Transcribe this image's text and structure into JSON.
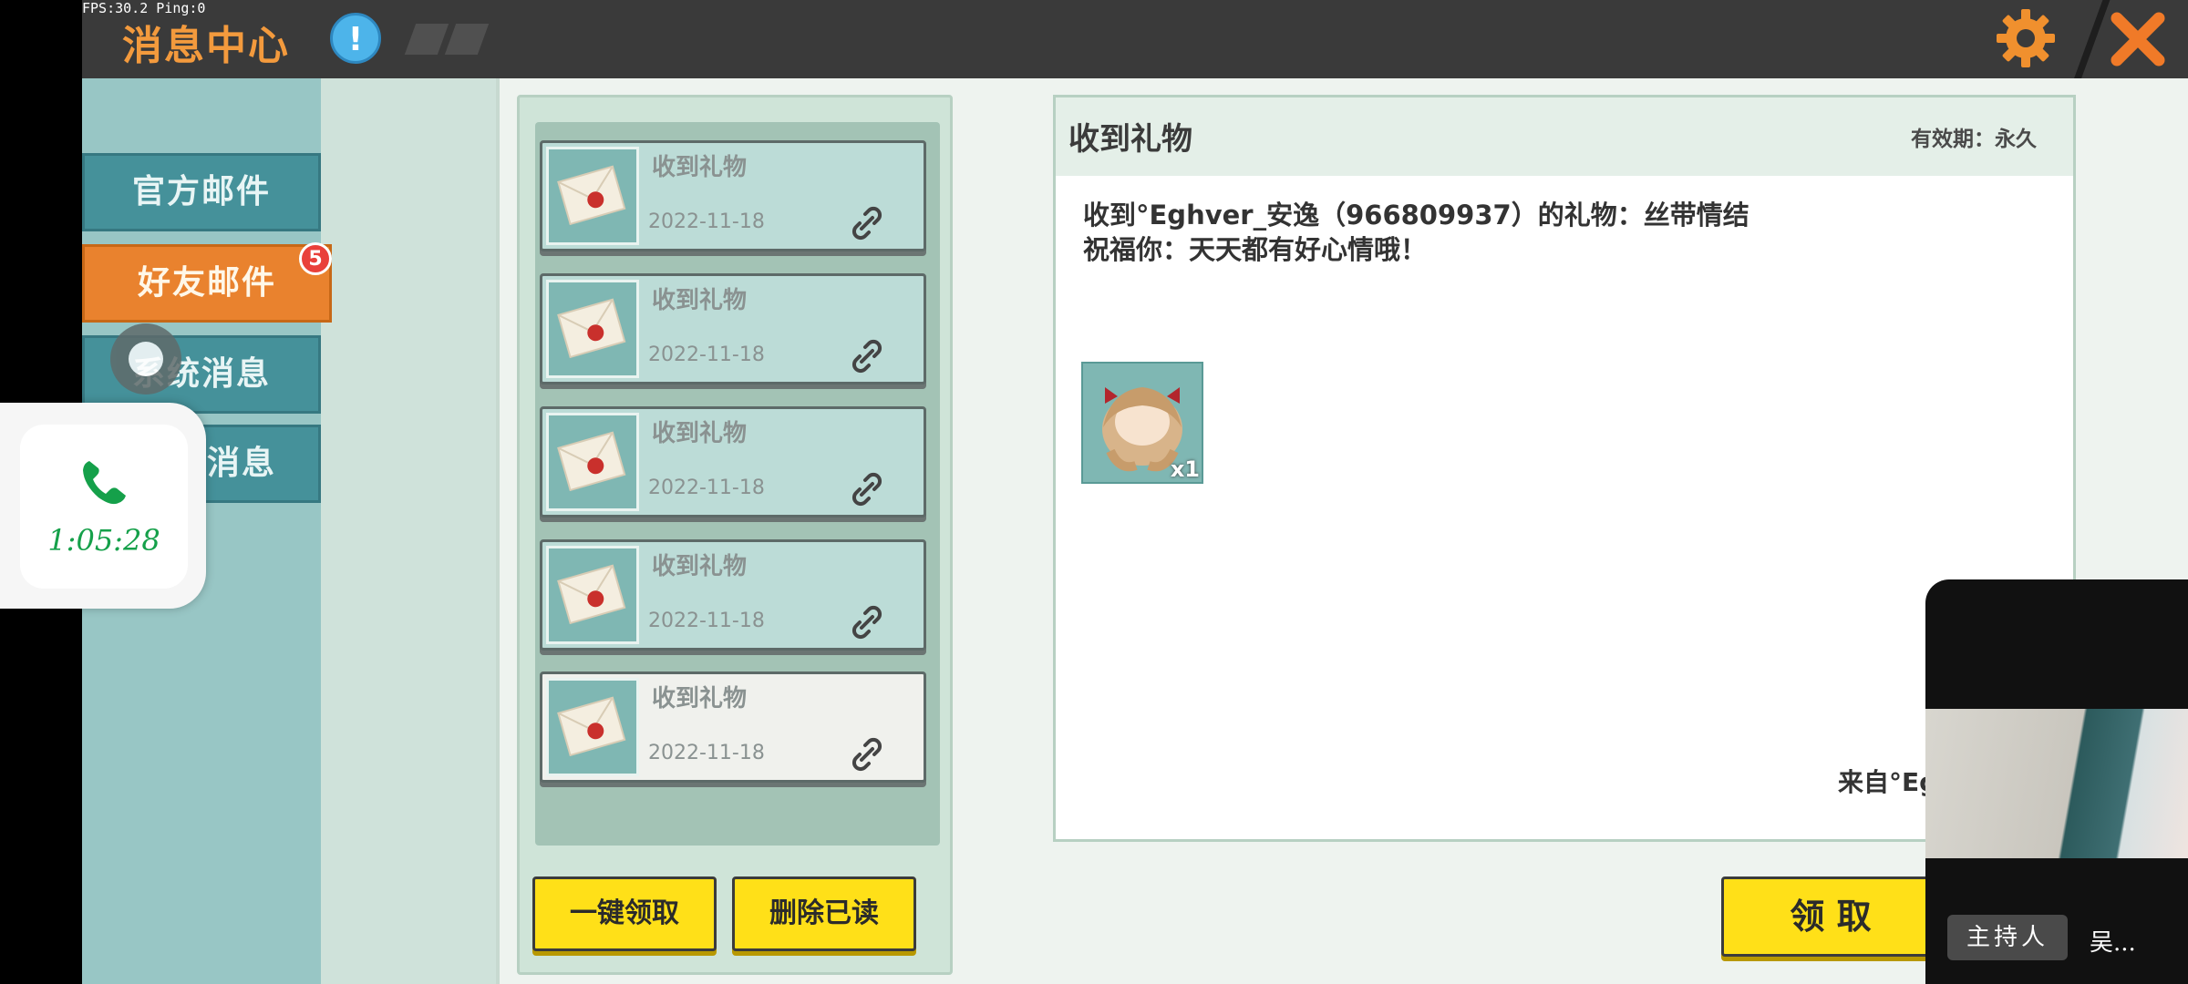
{
  "status": {
    "fps_text": "FPS:30.2  Ping:0"
  },
  "header": {
    "title": "消息中心",
    "info_icon": "!",
    "icons": [
      "settings-gear-icon",
      "close-x-icon"
    ]
  },
  "sidebar": {
    "tabs": [
      {
        "label": "官方邮件",
        "active": false
      },
      {
        "label": "好友邮件",
        "active": true,
        "badge": "5"
      },
      {
        "label": "系统消息",
        "active": false
      },
      {
        "label": "消息",
        "active": false
      }
    ]
  },
  "mail_list": {
    "items": [
      {
        "title": "收到礼物",
        "date": "2022-11-18",
        "selected": false
      },
      {
        "title": "收到礼物",
        "date": "2022-11-18",
        "selected": false
      },
      {
        "title": "收到礼物",
        "date": "2022-11-18",
        "selected": false
      },
      {
        "title": "收到礼物",
        "date": "2022-11-18",
        "selected": false
      },
      {
        "title": "收到礼物",
        "date": "2022-11-18",
        "selected": true
      }
    ],
    "claim_all_label": "一键领取",
    "delete_read_label": "删除已读"
  },
  "detail": {
    "title": "收到礼物",
    "validity": "有效期：永久",
    "line1": "收到°Eghver_安逸（966809937）的礼物：丝带情结",
    "line2": "祝福你：天天都有好心情哦！",
    "item_count": "x1",
    "from": "来自°Eghver_安",
    "claim_label": "领 取"
  },
  "call_overlay": {
    "time": "1:05:28"
  },
  "video_overlay": {
    "host_tag": "主持人",
    "host_name": "吴..."
  },
  "colors": {
    "accent_orange": "#e9822e",
    "tab_teal": "#45919a",
    "button_yellow": "#ffe018",
    "call_green": "#15a04a"
  }
}
